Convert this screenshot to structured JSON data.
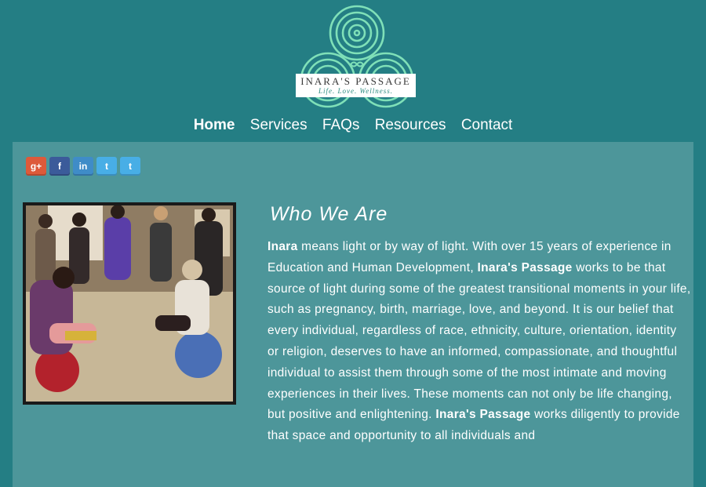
{
  "logo": {
    "name": "INARA'S PASSAGE",
    "tagline": "Life. Love. Wellness."
  },
  "colors": {
    "background": "#247e84",
    "panel": "#4d969a",
    "logo_accent": "#7fe0b8"
  },
  "nav": {
    "items": [
      {
        "label": "Home",
        "active": true
      },
      {
        "label": "Services",
        "active": false
      },
      {
        "label": "FAQs",
        "active": false
      },
      {
        "label": "Resources",
        "active": false
      },
      {
        "label": "Contact",
        "active": false
      }
    ]
  },
  "social": {
    "buttons": [
      {
        "label": "g+",
        "icon": "google-plus-icon",
        "color": "#dd5a3a"
      },
      {
        "label": "f",
        "icon": "facebook-icon",
        "color": "#3b5b9a"
      },
      {
        "label": "in",
        "icon": "linkedin-icon",
        "color": "#3f8cc8"
      },
      {
        "label": "t",
        "icon": "twitter-icon",
        "color": "#48aee6"
      },
      {
        "label": "t",
        "icon": "twitter-icon",
        "color": "#48aee6"
      }
    ]
  },
  "content": {
    "heading": "Who We Are",
    "paragraph": {
      "b1": "Inara",
      "t1": " means light or by way of light. With over 15 years of experience in Education and Human Development, ",
      "b2": "Inara's Passage",
      "t2": " works to be that source of light during some of the greatest transitional moments in your life, such as pregnancy, birth, marriage, love, and beyond. It is our belief that every individual, regardless of race, ethnicity, culture, orientation, identity or religion, deserves to have an informed, compassionate, and thoughtful individual to assist them through some of the most intimate and moving experiences in their lives. These moments can not only be life changing, but positive and enlightening. ",
      "b3": "Inara's Passage",
      "t3": " works diligently to provide that space and opportunity to all individuals and"
    }
  }
}
